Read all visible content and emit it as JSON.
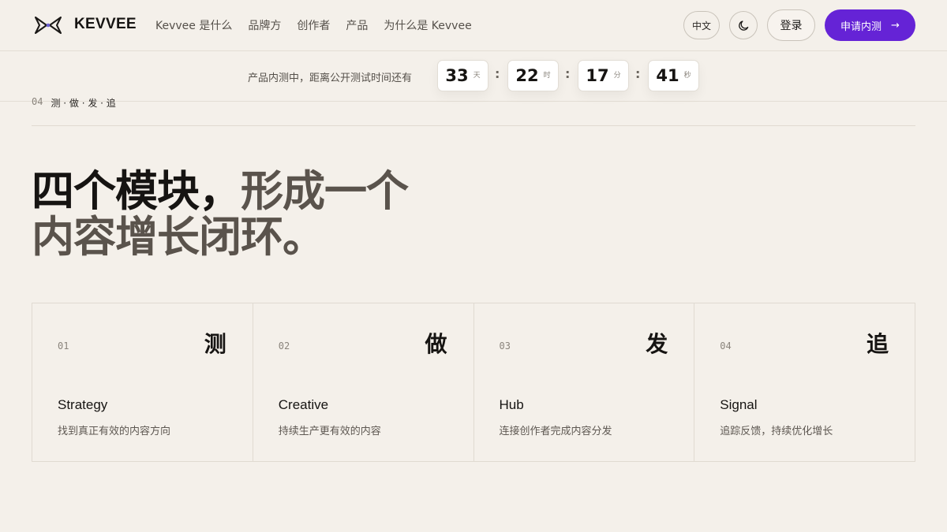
{
  "header": {
    "brand": "KEVVEE",
    "nav": [
      {
        "label": "Kevvee 是什么"
      },
      {
        "label": "品牌方"
      },
      {
        "label": "创作者"
      },
      {
        "label": "产品"
      },
      {
        "label": "为什么是 Kevvee"
      }
    ],
    "lang_label": "中文",
    "theme_icon": "moon-icon",
    "login_label": "登录",
    "cta_label": "申请内测",
    "cta_arrow": "→"
  },
  "countdown": {
    "text": "产品内测中，距离公开测试时间还有",
    "separator": ":",
    "units": [
      {
        "value": "33",
        "unit": "天"
      },
      {
        "value": "22",
        "unit": "时"
      },
      {
        "value": "17",
        "unit": "分"
      },
      {
        "value": "41",
        "unit": "秒"
      }
    ]
  },
  "section": {
    "number": "04",
    "label": "测 · 做 · 发 · 追"
  },
  "headline": {
    "dark": "四个模块，",
    "muted": "形成一个内容增长闭环。"
  },
  "modules": [
    {
      "num": "01",
      "char": "测",
      "title": "Strategy",
      "desc": "找到真正有效的内容方向"
    },
    {
      "num": "02",
      "char": "做",
      "title": "Creative",
      "desc": "持续生产更有效的内容"
    },
    {
      "num": "03",
      "char": "发",
      "title": "Hub",
      "desc": "连接创作者完成内容分发"
    },
    {
      "num": "04",
      "char": "追",
      "title": "Signal",
      "desc": "追踪反馈，持续优化增长"
    }
  ],
  "colors": {
    "background": "#f4f0ea",
    "accent": "#6523d6",
    "text": "#161412",
    "muted_text": "#5a534c"
  }
}
